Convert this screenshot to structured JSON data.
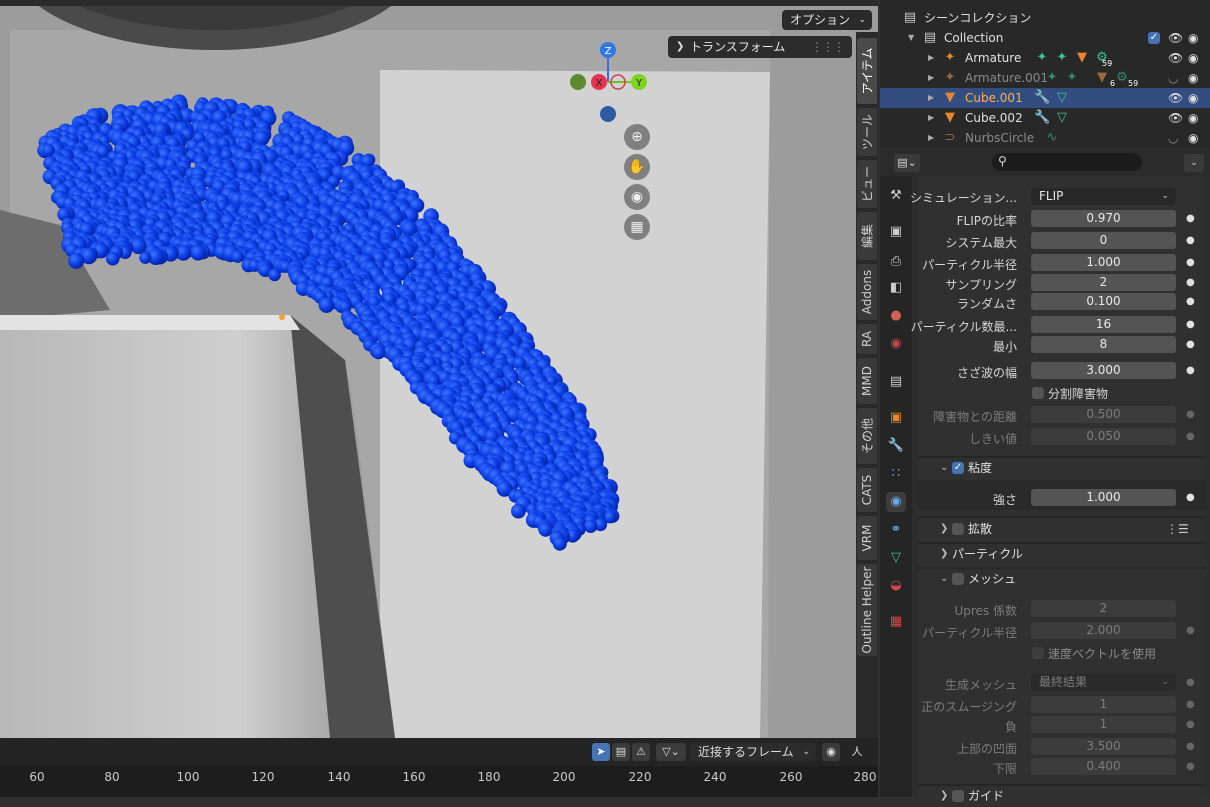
{
  "viewport": {
    "options_label": "オプション",
    "transform_panel_label": "トランスフォーム",
    "gizmo": {
      "z": "Z",
      "x": "X",
      "y": "Y"
    },
    "nav_icons": [
      "zoom-icon",
      "hand-icon",
      "camera-icon",
      "grid-icon"
    ]
  },
  "vtabs": [
    "アイテム",
    "ツール",
    "ビュー",
    "編集",
    "Addons",
    "RA",
    "MMD",
    "その他",
    "CATS",
    "VRM",
    "Outline Helper"
  ],
  "timeline": {
    "frame_mode": "近接するフレーム",
    "person_icon": "人",
    "ticks": [
      "60",
      "80",
      "100",
      "120",
      "140",
      "160",
      "180",
      "200",
      "220",
      "240",
      "260",
      "280"
    ]
  },
  "outliner": {
    "scene_collection": "シーンコレクション",
    "collection": "Collection",
    "items": [
      {
        "name": "Armature",
        "badge": "59"
      },
      {
        "name": "Armature.001",
        "badge1": "6",
        "badge2": "59"
      },
      {
        "name": "Cube.001"
      },
      {
        "name": "Cube.002"
      },
      {
        "name": "NurbsCircle"
      }
    ]
  },
  "props": {
    "sim_label": "シミュレーション...",
    "sim_value": "FLIP",
    "fields": [
      {
        "label": "FLIPの比率",
        "value": "0.970"
      },
      {
        "label": "システム最大",
        "value": "0"
      },
      {
        "label": "パーティクル半径",
        "value": "1.000"
      },
      {
        "label": "サンプリング",
        "value": "2"
      },
      {
        "label": "ランダムさ",
        "value": "0.100"
      },
      {
        "label": "パーティクル数最...",
        "value": "16"
      },
      {
        "label": "最小",
        "value": "8"
      },
      {
        "label": "さざ波の幅",
        "value": "3.000"
      }
    ],
    "split_obstacle": "分割障害物",
    "obstacle_distance": {
      "label": "障害物との距離",
      "value": "0.500"
    },
    "threshold": {
      "label": "しきい値",
      "value": "0.050"
    },
    "viscosity": "粘度",
    "strength": {
      "label": "強さ",
      "value": "1.000"
    },
    "diffusion": "拡散",
    "particles": "パーティクル",
    "mesh": "メッシュ",
    "upres": {
      "label": "Upres 係数",
      "value": "2"
    },
    "mesh_particle_radius": {
      "label": "パーティクル半径",
      "value": "2.000"
    },
    "use_velocity": "速度ベクトルを使用",
    "generate_mesh": {
      "label": "生成メッシュ",
      "value": "最終結果"
    },
    "smooth_pos": {
      "label": "正のスムージング",
      "value": "1"
    },
    "smooth_neg": {
      "label": "負",
      "value": "1"
    },
    "concave_upper": {
      "label": "上部の凹面",
      "value": "3.500"
    },
    "concave_lower": {
      "label": "下限",
      "value": "0.400"
    },
    "guide": "ガイド"
  }
}
